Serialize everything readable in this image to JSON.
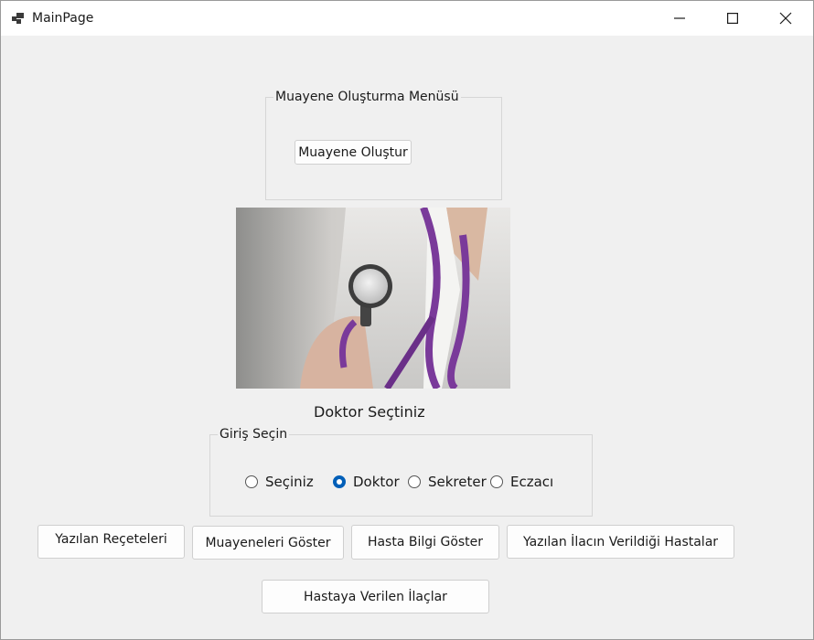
{
  "window": {
    "title": "MainPage",
    "controls": [
      "minimize-icon",
      "maximize-icon",
      "close-icon"
    ]
  },
  "muayene_group": {
    "label": "Muayene Oluşturma Menüsü",
    "create_button": "Muayene Oluştur"
  },
  "status_text": "Doktor Seçtiniz",
  "giris_group": {
    "label": "Giriş Seçin",
    "options": [
      {
        "label": "Seçiniz",
        "checked": false
      },
      {
        "label": "Doktor",
        "checked": true
      },
      {
        "label": "Sekreter",
        "checked": false
      },
      {
        "label": "Eczacı",
        "checked": false
      }
    ]
  },
  "buttons": {
    "yazilan_receteler": "Yazılan Reçeteleri",
    "muayeneleri_goster": "Muayeneleri Göster",
    "hasta_bilgi_goster": "Hasta Bilgi Göster",
    "yazilan_ilac_hastalar": "Yazılan İlacın Verildiği Hastalar",
    "hastaya_verilen_ilaclar": "Hastaya Verilen İlaçlar"
  },
  "colors": {
    "accent": "#005fb8",
    "background": "#f0f0f0",
    "stethoscope": "#7a3a9a"
  }
}
